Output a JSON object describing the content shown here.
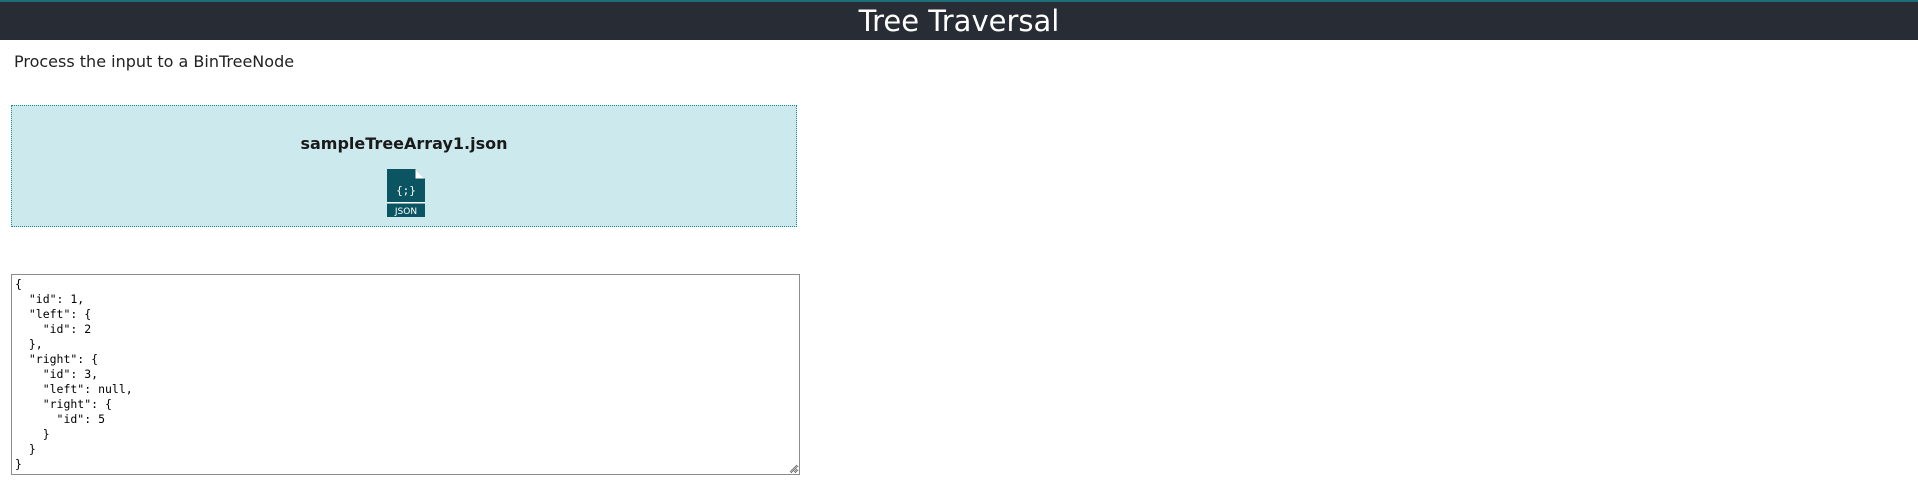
{
  "header": {
    "title": "Tree Traversal"
  },
  "instruction": {
    "text": "Process the input to a BinTreeNode"
  },
  "dropzone": {
    "file_name": "sampleTreeArray1.json",
    "icon": "json-file-icon",
    "icon_label": "JSON",
    "icon_glyph": "{;}"
  },
  "editor": {
    "value": "{\n  \"id\": 1,\n  \"left\": {\n    \"id\": 2\n  },\n  \"right\": {\n    \"id\": 3,\n    \"left\": null,\n    \"right\": {\n      \"id\": 5\n    }\n  }\n}"
  },
  "colors": {
    "header_bg": "#282c34",
    "dropzone_bg": "#cce9ee",
    "dropzone_border": "#1f8a8a",
    "icon_color": "#0b5563"
  }
}
